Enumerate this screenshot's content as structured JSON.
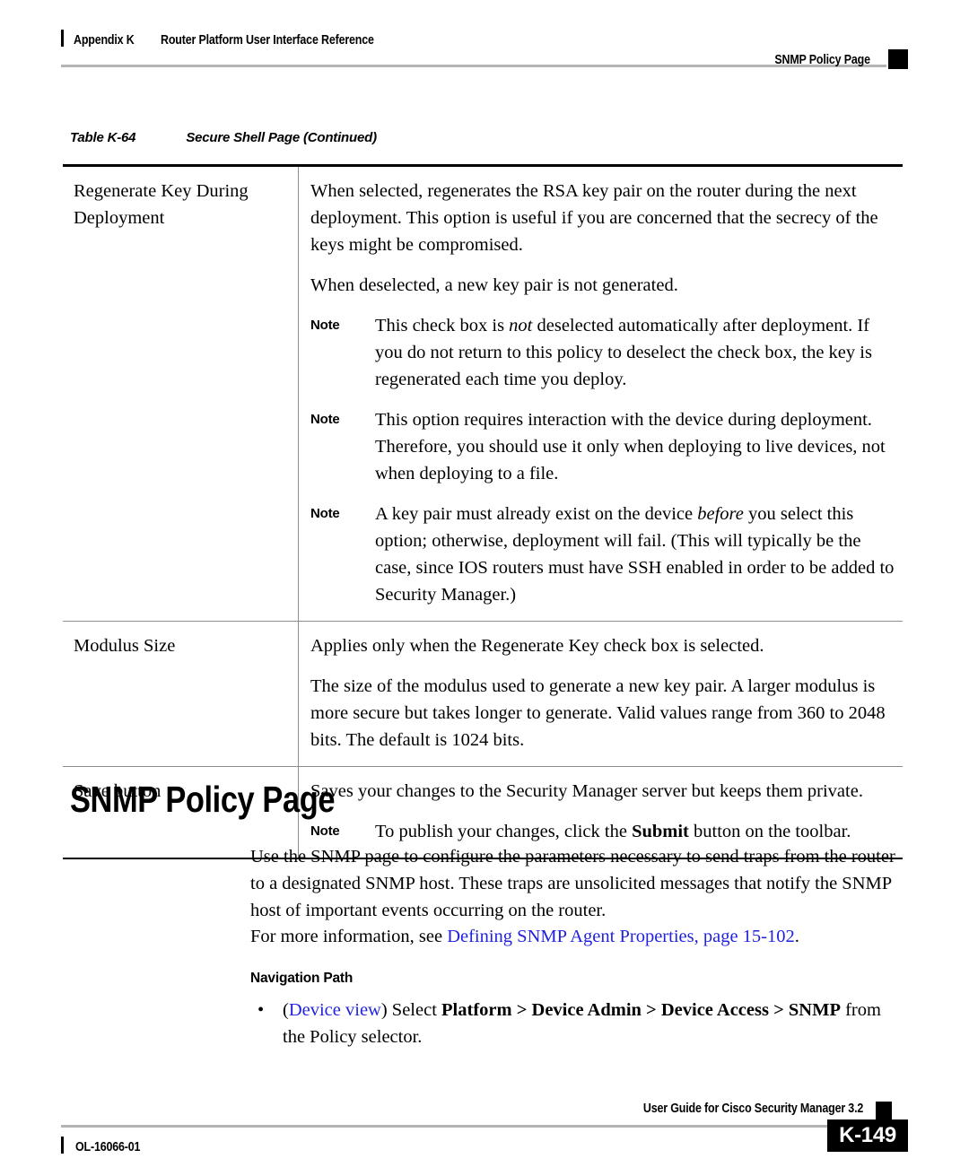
{
  "header": {
    "appendix": "Appendix K",
    "title": "Router Platform User Interface Reference",
    "right_marker": "SNMP Policy Page"
  },
  "table_caption": {
    "number": "Table K-64",
    "title": "Secure Shell Page (Continued)"
  },
  "table": {
    "rows": [
      {
        "term": "Regenerate Key During Deployment",
        "paragraphs": [
          "When selected, regenerates the RSA key pair on the router during the next deployment. This option is useful if you are concerned that the secrecy of the keys might be compromised.",
          "When deselected, a new key pair is not generated."
        ],
        "notes": [
          {
            "label": "Note",
            "before": "This check box is ",
            "italic": "not",
            "after": " deselected automatically after deployment. If you do not return to this policy to deselect the check box, the key is regenerated each time you deploy."
          },
          {
            "label": "Note",
            "before": "This option requires interaction with the device during deployment. Therefore, you should use it only when deploying to live devices, not when deploying to a file.",
            "italic": "",
            "after": ""
          },
          {
            "label": "Note",
            "before": "A key pair must already exist on the device ",
            "italic": "before",
            "after": " you select this option; otherwise, deployment will fail. (This will typically be the case, since IOS routers must have SSH enabled in order to be added to Security Manager.)"
          }
        ]
      },
      {
        "term": "Modulus Size",
        "paragraphs": [
          "Applies only when the Regenerate Key check box is selected.",
          "The size of the modulus used to generate a new key pair. A larger modulus is more secure but takes longer to generate. Valid values range from 360 to 2048 bits. The default is 1024 bits."
        ],
        "notes": []
      },
      {
        "term": "Save button",
        "paragraphs": [
          "Saves your changes to the Security Manager server but keeps them private."
        ],
        "notes": [
          {
            "label": "Note",
            "before": "To publish your changes, click the ",
            "bold": "Submit",
            "after": " button on the toolbar."
          }
        ]
      }
    ]
  },
  "section": {
    "heading": "SNMP Policy Page",
    "intro": "Use the SNMP page to configure the parameters necessary to send traps from the router to a designated SNMP host. These traps are unsolicited messages that notify the SNMP host of important events occurring on the router.",
    "xref_prefix": "For more information, see ",
    "xref_link": "Defining SNMP Agent Properties, page 15-102",
    "xref_suffix": ".",
    "nav_heading": "Navigation Path",
    "nav_bullet_dot": "•",
    "nav_open_paren": "(",
    "nav_link": "Device view",
    "nav_close_paren": ") Select ",
    "nav_path_bold": "Platform > Device Admin > Device Access > SNMP",
    "nav_tail": " from the Policy selector."
  },
  "footer": {
    "doc_id": "OL-16066-01",
    "guide_title": "User Guide for Cisco Security Manager 3.2",
    "page_number": "K-149"
  }
}
